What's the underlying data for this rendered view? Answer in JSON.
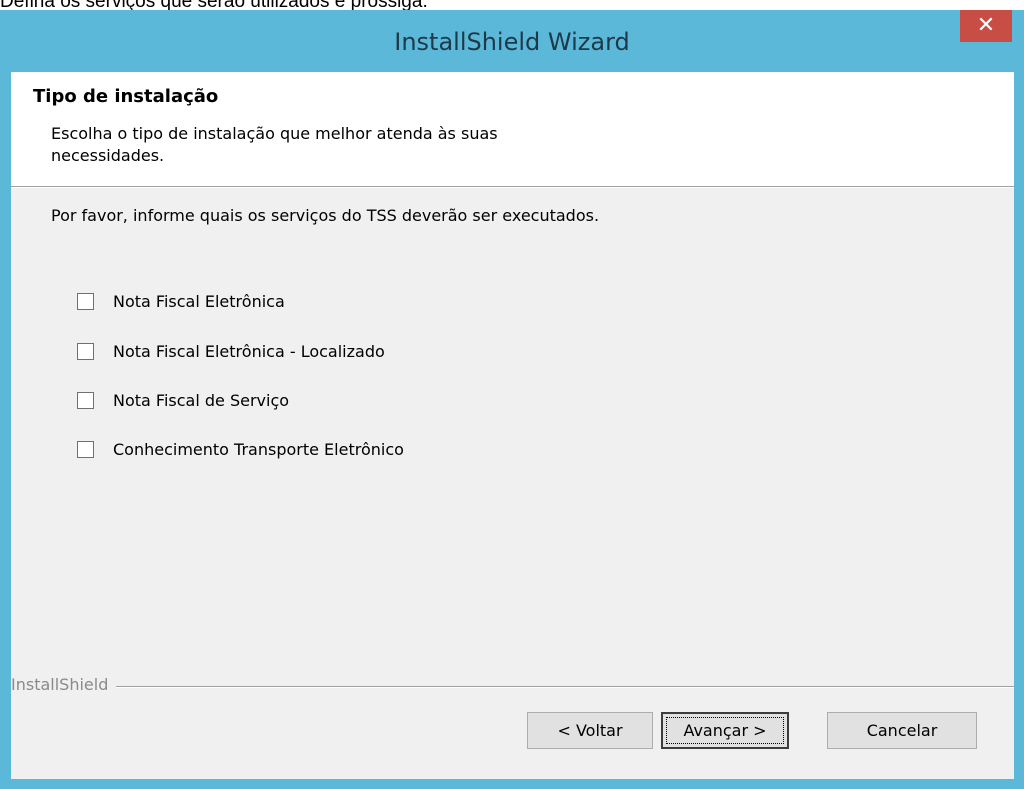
{
  "caption": "Defina os serviços que serão utilizados e prossiga.",
  "window": {
    "title": "InstallShield Wizard",
    "close_glyph": "✕"
  },
  "header": {
    "title": "Tipo de instalação",
    "description": "Escolha o tipo de instalação que melhor atenda às suas necessidades."
  },
  "instruction": "Por favor, informe quais os serviços do TSS deverão ser executados.",
  "options": [
    {
      "label": "Nota Fiscal Eletrônica",
      "checked": false
    },
    {
      "label": "Nota Fiscal Eletrônica - Localizado",
      "checked": false
    },
    {
      "label": "Nota Fiscal de Serviço",
      "checked": false
    },
    {
      "label": "Conhecimento Transporte Eletrônico",
      "checked": false
    }
  ],
  "brand": "InstallShield",
  "buttons": {
    "back": "< Voltar",
    "next": "Avançar >",
    "cancel": "Cancelar"
  },
  "colors": {
    "title_bar": "#5cb8d8",
    "close_button": "#c74d45",
    "dialog_background": "#f0f0f0"
  }
}
